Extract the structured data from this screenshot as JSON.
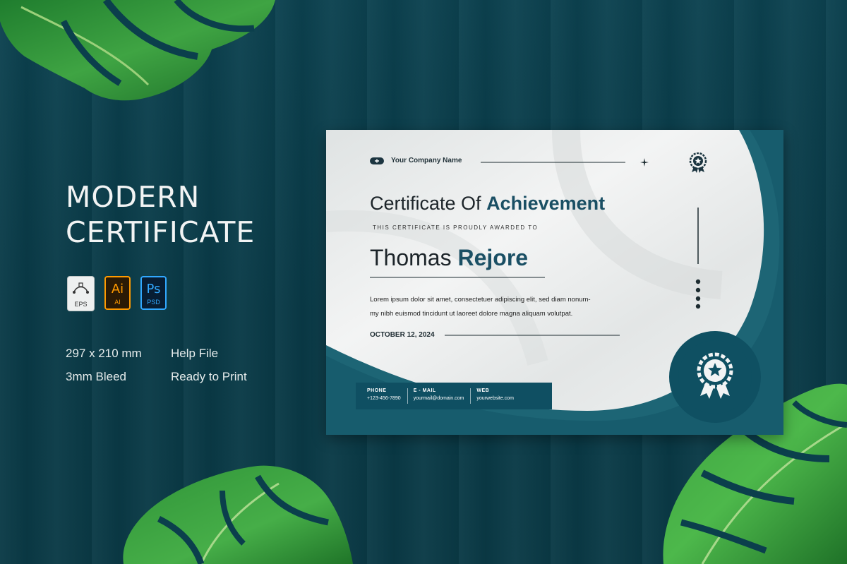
{
  "promo": {
    "title_line1": "MODERN",
    "title_line2": "CERTIFICATE",
    "file_types": [
      {
        "symbol": "",
        "label": "EPS",
        "icon": "vector-pen-icon"
      },
      {
        "symbol": "Ai",
        "label": "AI",
        "icon": "illustrator-icon"
      },
      {
        "symbol": "Ps",
        "label": "PSD",
        "icon": "photoshop-icon"
      }
    ],
    "specs": {
      "size": "297 x 210 mm",
      "bleed": "3mm Bleed",
      "help": "Help File",
      "print": "Ready to Print"
    }
  },
  "certificate": {
    "company": "Your Company Name",
    "title_part1": "Certificate Of",
    "title_part2": "Achievement",
    "awarded_line": "THIS CERTIFICATE IS PROUDLY AWARDED TO",
    "first_name": "Thomas",
    "last_name": "Rejore",
    "body_line1": "Lorem ipsum dolor sit amet, consectetuer adipiscing elit, sed diam nonum-",
    "body_line2": "my nibh euismod tincidunt ut laoreet dolore magna aliquam volutpat.",
    "date": "OCTOBER 12, 2024",
    "contact": {
      "phone_label": "PHONE",
      "phone_value": "+123-456-7890",
      "email_label": "E - MAIL",
      "email_value": "yourmail@domain.com",
      "web_label": "WEB",
      "web_value": "yourwebsite.com"
    }
  },
  "colors": {
    "background": "#0b3f4c",
    "certificate_teal": "#0f5062",
    "accent_text": "#1a4f64",
    "paper": "#e9eceb"
  }
}
